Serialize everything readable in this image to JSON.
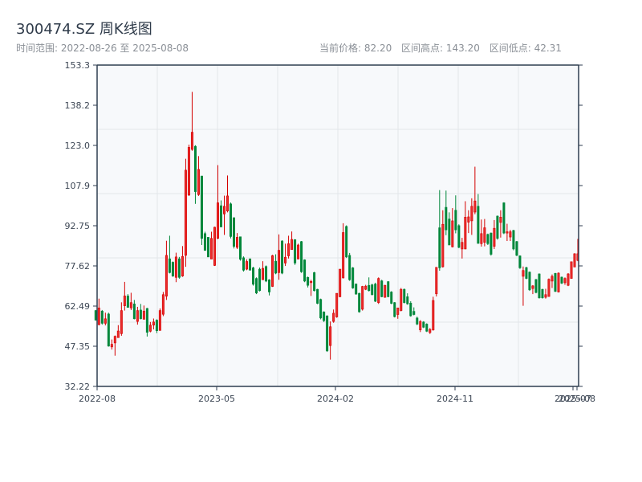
{
  "header": {
    "title": "300474.SZ 周K线图",
    "range_label": "时间范围: 2022-08-26 至 2025-08-08",
    "current_price": "当前价格: 82.20",
    "range_high": "区间高点: 143.20",
    "range_low": "区间低点: 42.31"
  },
  "colors": {
    "up": "#d40000",
    "up_fill": "#ea2a2a",
    "down": "#00873a",
    "plot_bg": "#f7f9fb",
    "grid": "#e3e6ea",
    "axis": "#2f3e50"
  },
  "chart_data": {
    "type": "candlestick",
    "title": "300474.SZ 周K线图",
    "ylim": [
      32.22,
      153.3
    ],
    "y_ticks": [
      "153.3",
      "138.2",
      "123.0",
      "107.9",
      "92.75",
      "77.62",
      "62.49",
      "47.35",
      "32.22"
    ],
    "x_ticks": [
      "2022-08",
      "2023-05",
      "2024-02",
      "2024-11",
      "2025-07",
      "2025-08"
    ],
    "grid": true,
    "ohlc_format": [
      "open",
      "close",
      "low",
      "high"
    ],
    "ohlc": [
      [
        60.8,
        57.2,
        57,
        61
      ],
      [
        55.5,
        61.8,
        55.2,
        65.3
      ],
      [
        60.6,
        56,
        55.5,
        61
      ],
      [
        56,
        57.7,
        55.2,
        60
      ],
      [
        59.5,
        47.4,
        47.2,
        60
      ],
      [
        47.1,
        48.1,
        46.1,
        49.9
      ],
      [
        48.6,
        51.1,
        43.8,
        51.4
      ],
      [
        50.6,
        53.1,
        50.6,
        55.3
      ],
      [
        52.1,
        60.8,
        51.3,
        63.9
      ],
      [
        62.6,
        66.3,
        60.8,
        71.6
      ],
      [
        66.3,
        62,
        61.9,
        67
      ],
      [
        61.8,
        63.8,
        61,
        67.5
      ],
      [
        63.3,
        57.7,
        57.5,
        64.8
      ],
      [
        56.7,
        60.8,
        55.5,
        62.2
      ],
      [
        61,
        57.7,
        57.5,
        63.3
      ],
      [
        57.5,
        60.6,
        57.5,
        62.7
      ],
      [
        61.6,
        52.6,
        51,
        61.8
      ],
      [
        53,
        55.3,
        52.6,
        56.5
      ],
      [
        55.3,
        56.5,
        53.7,
        57.8
      ],
      [
        57.2,
        53.2,
        52.3,
        57.5
      ],
      [
        53.3,
        60.8,
        53.3,
        61.6
      ],
      [
        59.4,
        66.8,
        58.7,
        67.8
      ],
      [
        66.2,
        81.6,
        64.8,
        87.1
      ],
      [
        80.3,
        75.1,
        74.8,
        89
      ],
      [
        79,
        73.8,
        73.5,
        79.3
      ],
      [
        73.3,
        81,
        71.5,
        82.6
      ],
      [
        80.3,
        73.3,
        72.8,
        81
      ],
      [
        73.8,
        81.2,
        73.5,
        85.1
      ],
      [
        81.6,
        113.7,
        77.3,
        118
      ],
      [
        104.3,
        122.3,
        104,
        123.3
      ],
      [
        121.5,
        128,
        121,
        143.2
      ],
      [
        122.7,
        105.6,
        101,
        123.1
      ],
      [
        104.5,
        114,
        104,
        119
      ],
      [
        111.5,
        88,
        85.5,
        111.5
      ],
      [
        89.8,
        83.5,
        83.3,
        90.5
      ],
      [
        88.4,
        81,
        81,
        88.4
      ],
      [
        80.2,
        88,
        80.2,
        90.5
      ],
      [
        77.8,
        92.2,
        77.6,
        92.4
      ],
      [
        88,
        101.4,
        87.7,
        115.6
      ],
      [
        100.3,
        92.3,
        92.3,
        102.3
      ],
      [
        97.2,
        100.1,
        89.3,
        104.1
      ],
      [
        98.3,
        104,
        97.8,
        111.7
      ],
      [
        101,
        88.7,
        88,
        101.5
      ],
      [
        95.8,
        85,
        84.2,
        95.8
      ],
      [
        84.6,
        88.4,
        84,
        90
      ],
      [
        88.6,
        80.1,
        79.6,
        88.6
      ],
      [
        80.7,
        76,
        75.5,
        81.2
      ],
      [
        76.4,
        79.3,
        76,
        80.1
      ],
      [
        80.3,
        76,
        76,
        80.3
      ],
      [
        76.9,
        70.7,
        70.2,
        77.3
      ],
      [
        72.9,
        67.4,
        67,
        73.3
      ],
      [
        76.4,
        68.3,
        68,
        77
      ],
      [
        72.4,
        76.7,
        72.4,
        79.4
      ],
      [
        77.4,
        71.9,
        71.5,
        77.8
      ],
      [
        72.4,
        67.8,
        66.5,
        72.6
      ],
      [
        69.9,
        81.5,
        69.7,
        81.8
      ],
      [
        79.4,
        74.9,
        74.5,
        82
      ],
      [
        75.1,
        83.5,
        72.4,
        89.5
      ],
      [
        87,
        74.9,
        74.5,
        87.3
      ],
      [
        78.7,
        80.9,
        77.6,
        86
      ],
      [
        81.4,
        86,
        80.4,
        89
      ],
      [
        83.8,
        87.6,
        83.8,
        90.6
      ],
      [
        87.5,
        78.7,
        78,
        87.7
      ],
      [
        80.2,
        85.5,
        80.2,
        86
      ],
      [
        86.8,
        75.4,
        75,
        87
      ],
      [
        79.9,
        71.9,
        71.5,
        80.1
      ],
      [
        73.3,
        70.3,
        69.5,
        73.6
      ],
      [
        71.3,
        71.8,
        66.3,
        72.4
      ],
      [
        75.1,
        68.3,
        68,
        75.4
      ],
      [
        68.8,
        63.5,
        63.2,
        69
      ],
      [
        65,
        58,
        57.5,
        65.3
      ],
      [
        60.3,
        57,
        56.5,
        60.5
      ],
      [
        58.8,
        45.6,
        45.2,
        59
      ],
      [
        47.6,
        54.7,
        42.31,
        56.7
      ],
      [
        56.7,
        59.8,
        56.2,
        61.2
      ],
      [
        58.4,
        67.3,
        58.1,
        67.3
      ],
      [
        66,
        76.4,
        65.8,
        76.4
      ],
      [
        73.1,
        90.2,
        72.9,
        93.7
      ],
      [
        92.5,
        81,
        80.6,
        92.9
      ],
      [
        81.6,
        72.4,
        72,
        82.5
      ],
      [
        76.9,
        69.3,
        69,
        77.2
      ],
      [
        70.8,
        67,
        66.8,
        71
      ],
      [
        67.3,
        60.3,
        60,
        67.5
      ],
      [
        61.3,
        69.9,
        60.8,
        70.1
      ],
      [
        68.8,
        70,
        68.5,
        70.5
      ],
      [
        70.3,
        68.3,
        68,
        73.3
      ],
      [
        70.5,
        66.8,
        66.5,
        70.9
      ],
      [
        70.8,
        64.3,
        64,
        71.3
      ],
      [
        63.8,
        72.9,
        63.3,
        73.3
      ],
      [
        72,
        66,
        65.8,
        72.4
      ],
      [
        65.8,
        70.3,
        65.6,
        70.5
      ],
      [
        71.7,
        66,
        65.8,
        71.9
      ],
      [
        67.8,
        63.5,
        63.2,
        68.1
      ],
      [
        63.8,
        58.5,
        58.2,
        64
      ],
      [
        59.3,
        61.8,
        57.7,
        61.8
      ],
      [
        60.8,
        68.8,
        60.5,
        69.3
      ],
      [
        68.8,
        63.8,
        63.5,
        69.1
      ],
      [
        66,
        63.3,
        63,
        67.3
      ],
      [
        63.6,
        58.8,
        58.5,
        64.3
      ],
      [
        60.5,
        59.3,
        59,
        62
      ],
      [
        58,
        55.7,
        55.3,
        58.5
      ],
      [
        53.5,
        56.7,
        52.7,
        57.2
      ],
      [
        56.5,
        54.5,
        54.2,
        56.8
      ],
      [
        55.7,
        53,
        52.7,
        56
      ],
      [
        52.5,
        53.7,
        52,
        54.2
      ],
      [
        53.5,
        64.6,
        53.2,
        66
      ],
      [
        67.1,
        77.1,
        66.1,
        77.1
      ],
      [
        92,
        76.9,
        75.8,
        106.2
      ],
      [
        77.3,
        93.3,
        77,
        98.6
      ],
      [
        99.7,
        91.2,
        89.2,
        106
      ],
      [
        95.3,
        85.5,
        85.5,
        97.8
      ],
      [
        84.8,
        94.6,
        84.6,
        99.4
      ],
      [
        98.6,
        91.2,
        89.9,
        104.2
      ],
      [
        92.8,
        84.6,
        84.3,
        93.3
      ],
      [
        84,
        86.5,
        80.4,
        88.2
      ],
      [
        84,
        96,
        83.9,
        102
      ],
      [
        94.1,
        96.1,
        90,
        98.6
      ],
      [
        94.6,
        100.1,
        89.3,
        103.1
      ],
      [
        97.9,
        102.1,
        97.1,
        115
      ],
      [
        100.1,
        86.1,
        86,
        104.7
      ],
      [
        86,
        89.8,
        84.9,
        95.1
      ],
      [
        86.5,
        92,
        85,
        95.3
      ],
      [
        89.5,
        86,
        85.5,
        89.8
      ],
      [
        90,
        82,
        81.5,
        90.2
      ],
      [
        85,
        91.8,
        84,
        94.9
      ],
      [
        96.4,
        88,
        87.5,
        96.6
      ],
      [
        94,
        96,
        88.3,
        98.6
      ],
      [
        101.4,
        90,
        89.6,
        101.6
      ],
      [
        90,
        90.5,
        87,
        93.5
      ],
      [
        88.5,
        90.5,
        87,
        91.2
      ],
      [
        91,
        84,
        83.5,
        91.2
      ],
      [
        86.8,
        81.6,
        81.3,
        87
      ],
      [
        81.4,
        76.9,
        76.5,
        81.6
      ],
      [
        73.7,
        75.9,
        62.6,
        77.4
      ],
      [
        77,
        72.9,
        72.6,
        77.3
      ],
      [
        75.3,
        68.6,
        68.2,
        75.5
      ],
      [
        69.1,
        70.1,
        67,
        70.4
      ],
      [
        72.5,
        67.6,
        67.3,
        72.7
      ],
      [
        74.6,
        65.6,
        65.3,
        74.8
      ],
      [
        68.8,
        65.6,
        65.3,
        69
      ],
      [
        65.8,
        66.8,
        65.3,
        69
      ],
      [
        66.1,
        72.6,
        66,
        72.9
      ],
      [
        71.9,
        73.7,
        69.3,
        74.4
      ],
      [
        74.8,
        68,
        67.8,
        75
      ],
      [
        67.8,
        74.9,
        67.6,
        75.2
      ],
      [
        73.4,
        71.1,
        70.8,
        73.6
      ],
      [
        71.3,
        72.9,
        70.5,
        73.3
      ],
      [
        70.3,
        74.6,
        70,
        74.9
      ],
      [
        72.9,
        79.2,
        72.9,
        79.2
      ],
      [
        77.2,
        82.2,
        77.2,
        82.4
      ],
      [
        79.7,
        82.2,
        79.4,
        87.8
      ]
    ]
  }
}
